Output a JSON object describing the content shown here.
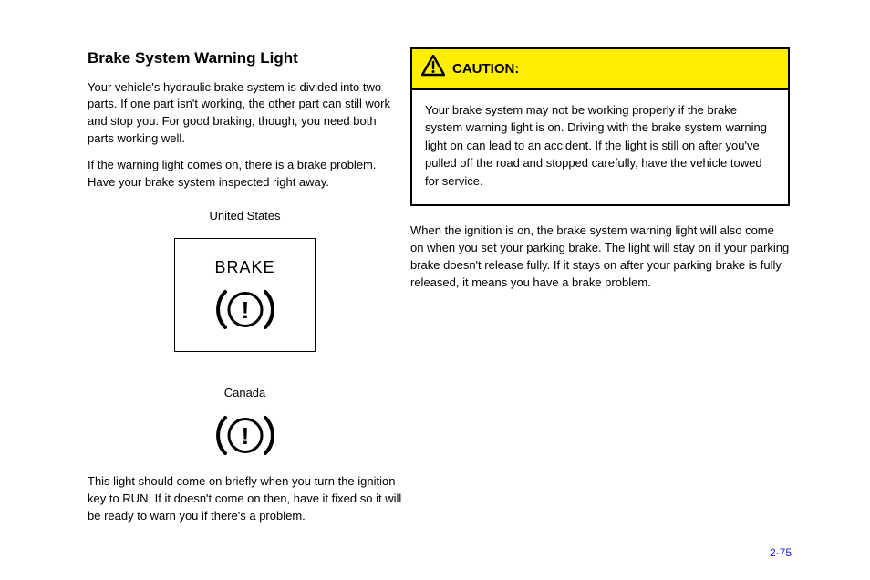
{
  "left": {
    "heading": "Brake System Warning Light",
    "intro": "Your vehicle's hydraulic brake system is divided into two parts. If one part isn't working, the other part can still work and stop you. For good braking, though, you need both parts working well.",
    "warning_light_text": "If the warning light comes on, there is a brake problem. Have your brake system inspected right away.",
    "united_states_label": "United States",
    "brake_label": "BRAKE",
    "canada_label": "Canada",
    "canada_text": "This light should come on briefly when you turn the ignition key to RUN. If it doesn't come on then, have it fixed so it will be ready to warn you if there's a problem."
  },
  "caution": {
    "header": "CAUTION:",
    "body": "Your brake system may not be working properly if the brake system warning light is on. Driving with the brake system warning light on can lead to an accident. If the light is still on after you've pulled off the road and stopped carefully, have the vehicle towed for service."
  },
  "right_body": "When the ignition is on, the brake system warning light will also come on when you set your parking brake. The light will stay on if your parking brake doesn't release fully. If it stays on after your parking brake is fully released, it means you have a brake problem.",
  "page_number": "2-75"
}
